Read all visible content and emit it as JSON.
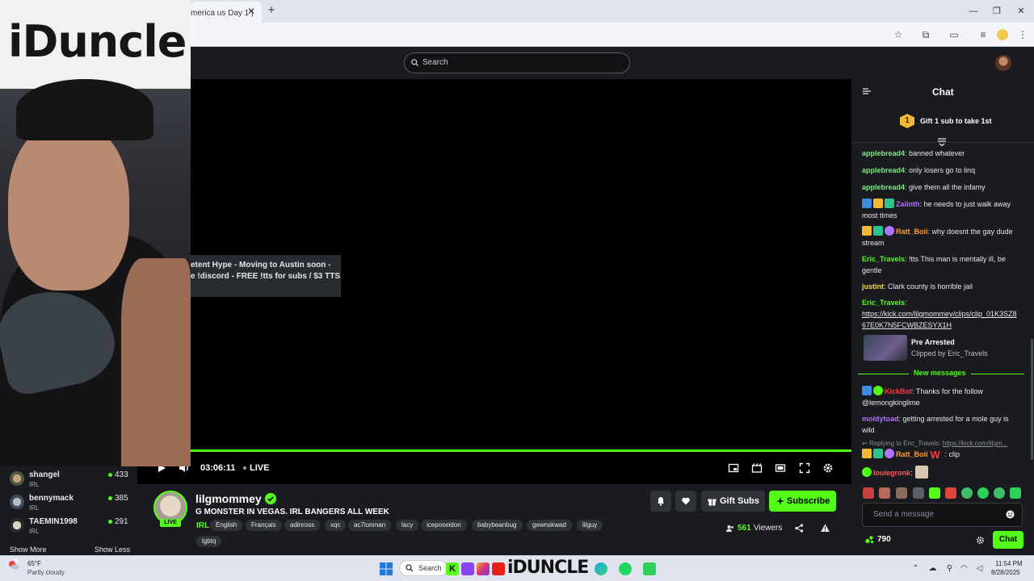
{
  "browser": {
    "tab_title": "merica us Day 1 |",
    "close_tab": "✕",
    "new_tab": "+",
    "minimize": "—",
    "restore": "❐",
    "close_window": "✕"
  },
  "site": {
    "search_placeholder": "Search"
  },
  "player": {
    "overlay_line1": "etent Hype - Moving to Austin soon -",
    "overlay_line2": "e !discord - FREE !tts for subs / $3 TTS",
    "elapsed": "03:06:11",
    "live_label": "LIVE",
    "progress_fraction": 1.0
  },
  "webcam": {
    "banner_text": "iDuncle"
  },
  "left_sidebar": {
    "channels": [
      {
        "name": "shangel",
        "category": "IRL",
        "viewers": "433"
      },
      {
        "name": "bennymack",
        "category": "IRL",
        "viewers": "385"
      },
      {
        "name": "TAEMIN1998",
        "category": "IRL",
        "viewers": "291"
      }
    ],
    "show_more": "Show More",
    "show_less": "Show Less"
  },
  "stream_info": {
    "streamer": "lilgmommey",
    "live_badge": "LIVE",
    "title": "G MONSTER IN VEGAS. IRL BANGERS ALL WEEK",
    "category": "IRL",
    "tags": [
      "English",
      "Français",
      "adinross",
      "xqc",
      "ac7ionman",
      "lacy",
      "iceposeidon",
      "babybeanbug",
      "gewnskwad",
      "lilguy",
      "lgbtq"
    ],
    "gift_subs": "Gift Subs",
    "subscribe": "Subscribe",
    "viewer_count": "561",
    "viewers_label": "Viewers"
  },
  "chat": {
    "title": "Chat",
    "gift_badge": "1",
    "gift_text": "Gift 1 sub to take 1st",
    "messages": [
      {
        "user": "applebread4",
        "color": "#7ee787",
        "text": ": banned whatever"
      },
      {
        "user": "applebread4",
        "color": "#7ee787",
        "text": ": only losers go to linq"
      },
      {
        "user": "applebread4",
        "color": "#7ee787",
        "text": ": give them all the infamy"
      },
      {
        "user": "Zaiinth",
        "color": "#b072ff",
        "text": ": he needs to just walk away most times"
      },
      {
        "user": "Ratt_Boii",
        "color": "#ff9b3d",
        "text": ": why doesnt the gay dude stream"
      },
      {
        "user": "Eric_Travels",
        "color": "#53fc18",
        "text": ": !tts This man is mentally ill, be gentle"
      },
      {
        "user": "justint",
        "color": "#f2d94a",
        "text": ": Clark county is horrible jail"
      },
      {
        "user": "Eric_Travels",
        "color": "#53fc18",
        "text": ":"
      },
      {
        "user": "KickBot",
        "color": "#ff3b3b",
        "text": ": Thanks for the follow @lemongkinglime"
      },
      {
        "user": "moldytoad",
        "color": "#b072ff",
        "text": ": getting arrested for a mole guy is wild"
      },
      {
        "user": "Ratt_Boii",
        "color": "#ff9b3d",
        "text": ": clip"
      },
      {
        "user": "louiegronk",
        "color": "#ff5a5a",
        "text": ":"
      }
    ],
    "link": "https://kick.com/lilgmommey/clips/clip_01K3SZ867E0K7N5FCWBZESYX1H",
    "clip_title": "Pre Arrested",
    "clip_by": "Clipped by Eric_Travels",
    "new_messages": "New messages",
    "reply_prefix": "Replying to Eric_Travels:",
    "reply_link": "https://kick.com/lilgm...",
    "input_placeholder": "Send a message",
    "points": "790",
    "send_label": "Chat"
  },
  "taskbar": {
    "temperature": "65°F",
    "weather": "Partly cloudy",
    "weather_badge": "9",
    "search": "Search",
    "pinned_label": "iDUNCLE",
    "time": "11:54 PM",
    "date": "8/28/2025"
  },
  "colors": {
    "accent": "#53fc18",
    "panel": "#191b1f",
    "background": "#0b0e0f"
  }
}
